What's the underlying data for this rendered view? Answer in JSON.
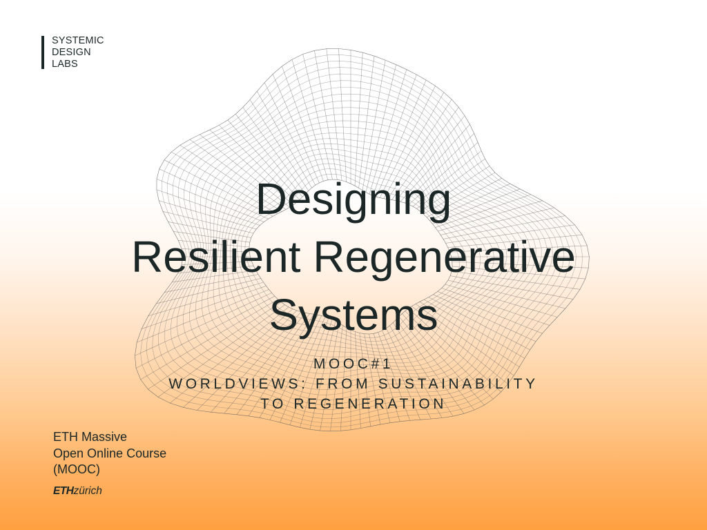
{
  "logo": {
    "lines": [
      "SYSTEMIC",
      "DESIGN",
      "LABS"
    ]
  },
  "title": {
    "lines": [
      "Designing",
      "Resilient Regenerative",
      "Systems"
    ]
  },
  "subtitle": {
    "lines": [
      "MOOC#1",
      "WORLDVIEWS: FROM SUSTAINABILITY",
      "TO REGENERATION"
    ]
  },
  "course": {
    "lines": [
      "ETH Massive",
      "Open Online Course",
      "(MOOC)"
    ]
  },
  "institution": {
    "bold": "ETH",
    "rest": "zürich"
  },
  "colors": {
    "text": "#1b2626",
    "gradient_bottom": "#ffa040",
    "mesh": "#5a5a5a"
  },
  "decoration": {
    "icon": "wireframe-torus-mesh"
  }
}
